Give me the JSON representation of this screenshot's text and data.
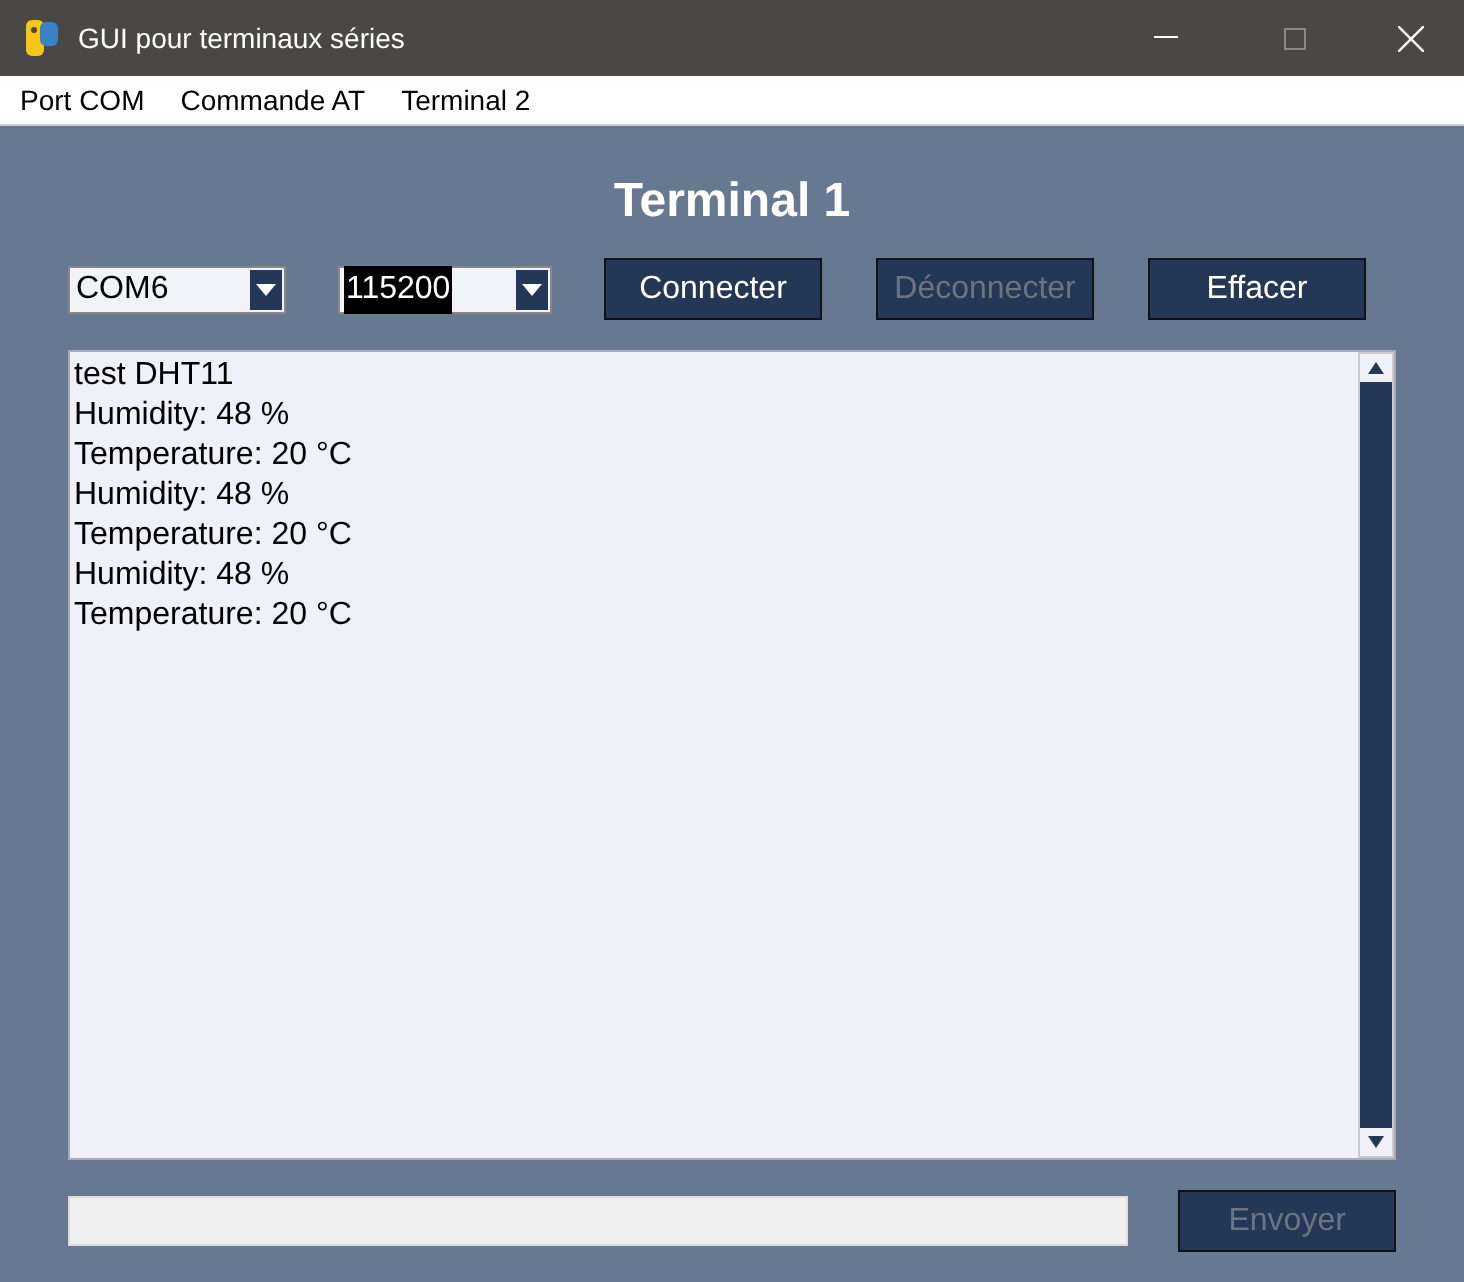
{
  "window": {
    "title": "GUI pour terminaux séries"
  },
  "menu": [
    "Port COM",
    "Commande AT",
    "Terminal 2"
  ],
  "heading": "Terminal 1",
  "port_select": {
    "value": "COM6",
    "highlighted": false
  },
  "baud_select": {
    "value": "115200",
    "highlighted": true
  },
  "buttons": [
    {
      "label": "Connecter",
      "disabled": false
    },
    {
      "label": "Déconnecter",
      "disabled": true
    },
    {
      "label": "Effacer",
      "disabled": false
    }
  ],
  "terminal": {
    "lines": [
      "test DHT11",
      "Humidity: 48 %",
      "Temperature: 20 °C",
      "Humidity: 48 %",
      "Temperature: 20 °C",
      "Humidity: 48 %",
      "Temperature: 20 °C"
    ]
  },
  "send_button": {
    "label": "Envoyer",
    "disabled": true
  }
}
